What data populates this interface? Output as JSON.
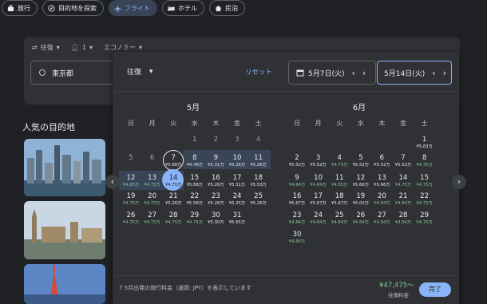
{
  "nav": {
    "tabs": [
      {
        "label": "旅行",
        "icon": "suitcase-icon"
      },
      {
        "label": "目的地を探索",
        "icon": "explore-icon"
      },
      {
        "label": "フライト",
        "icon": "flight-icon",
        "active": true
      },
      {
        "label": "ホテル",
        "icon": "hotel-icon"
      },
      {
        "label": "民泊",
        "icon": "house-icon"
      }
    ]
  },
  "search": {
    "trip_type": "往復",
    "passengers": "1",
    "cabin": "エコノミー",
    "origin": "東京都"
  },
  "popular_title": "人気の目的地",
  "calendar": {
    "trip_type": "往復",
    "reset_label": "リセット",
    "departure_date": "5月7日(火)",
    "return_date": "5月14日(火)",
    "weekdays": [
      "日",
      "月",
      "火",
      "水",
      "木",
      "金",
      "土"
    ],
    "months": [
      {
        "title": "5月",
        "first_weekday": 3,
        "days": [
          {
            "d": "1",
            "p": ""
          },
          {
            "d": "2",
            "p": ""
          },
          {
            "d": "3",
            "p": ""
          },
          {
            "d": "4",
            "p": ""
          },
          {
            "d": "5",
            "p": ""
          },
          {
            "d": "6",
            "p": ""
          },
          {
            "d": "7",
            "p": "¥5.88万"
          },
          {
            "d": "8",
            "p": "¥4.49万"
          },
          {
            "d": "9",
            "p": "¥5.31万"
          },
          {
            "d": "10",
            "p": "¥5.26万"
          },
          {
            "d": "11",
            "p": "¥5.26万"
          },
          {
            "d": "12",
            "p": "¥4.83万",
            "g": true
          },
          {
            "d": "13",
            "p": "¥4.75万",
            "g": true
          },
          {
            "d": "14",
            "p": "¥4.75万",
            "g": true
          },
          {
            "d": "15",
            "p": "¥5.68万"
          },
          {
            "d": "16",
            "p": "¥5.26万"
          },
          {
            "d": "17",
            "p": "¥5.31万"
          },
          {
            "d": "18",
            "p": "¥5.53万"
          },
          {
            "d": "19",
            "p": "¥4.75万",
            "g": true
          },
          {
            "d": "20",
            "p": "¥4.75万",
            "g": true
          },
          {
            "d": "21",
            "p": "¥5.26万"
          },
          {
            "d": "22",
            "p": "¥5.58万"
          },
          {
            "d": "23",
            "p": "¥5.26万"
          },
          {
            "d": "24",
            "p": "¥5.25万"
          },
          {
            "d": "25",
            "p": "¥5.26万"
          },
          {
            "d": "26",
            "p": "¥4.75万",
            "g": true
          },
          {
            "d": "27",
            "p": "¥4.75万",
            "g": true
          },
          {
            "d": "28",
            "p": "¥4.75万",
            "g": true
          },
          {
            "d": "29",
            "p": "¥4.75万",
            "g": true
          },
          {
            "d": "30",
            "p": "¥5.30万"
          },
          {
            "d": "31",
            "p": "¥5.65万"
          }
        ]
      },
      {
        "title": "6月",
        "first_weekday": 6,
        "days": [
          {
            "d": "1",
            "p": "¥5.83万"
          },
          {
            "d": "2",
            "p": "¥5.52万"
          },
          {
            "d": "3",
            "p": "¥5.52万"
          },
          {
            "d": "4",
            "p": "¥4.75万",
            "g": true
          },
          {
            "d": "5",
            "p": "¥5.52万"
          },
          {
            "d": "6",
            "p": "¥5.52万"
          },
          {
            "d": "7",
            "p": "¥5.52万"
          },
          {
            "d": "8",
            "p": "¥4.75万",
            "g": true
          },
          {
            "d": "9",
            "p": "¥4.84万",
            "g": true
          },
          {
            "d": "10",
            "p": "¥4.84万",
            "g": true
          },
          {
            "d": "11",
            "p": "¥4.85万",
            "g": true
          },
          {
            "d": "12",
            "p": "¥5.66万"
          },
          {
            "d": "13",
            "p": "¥5.66万"
          },
          {
            "d": "14",
            "p": "¥4.75万",
            "g": true
          },
          {
            "d": "15",
            "p": "¥4.75万",
            "g": true
          },
          {
            "d": "16",
            "p": "¥5.67万"
          },
          {
            "d": "17",
            "p": "¥5.67万"
          },
          {
            "d": "18",
            "p": "¥5.67万"
          },
          {
            "d": "19",
            "p": "¥5.02万"
          },
          {
            "d": "20",
            "p": "¥4.84万",
            "g": true
          },
          {
            "d": "21",
            "p": "¥4.84万",
            "g": true
          },
          {
            "d": "22",
            "p": "¥4.75万",
            "g": true
          },
          {
            "d": "23",
            "p": "¥4.84万",
            "g": true
          },
          {
            "d": "24",
            "p": "¥4.84万",
            "g": true
          },
          {
            "d": "25",
            "p": "¥4.84万",
            "g": true
          },
          {
            "d": "26",
            "p": "¥4.84万",
            "g": true
          },
          {
            "d": "27",
            "p": "¥4.84万",
            "g": true
          },
          {
            "d": "28",
            "p": "¥4.84万",
            "g": true
          },
          {
            "d": "29",
            "p": "¥4.75万",
            "g": true
          },
          {
            "d": "30",
            "p": "¥4.84万",
            "g": true
          }
        ]
      }
    ],
    "footer_note": "7 5月出発の旅行料金（通貨: JPY）を表示しています",
    "total_price": "¥47,475～",
    "price_label": "往復料金",
    "done_label": "完了"
  },
  "colors": {
    "background": "#202124",
    "panel": "#303134",
    "accent": "#8ab4f8",
    "range": "#394457",
    "cheap_price": "#81c995"
  }
}
